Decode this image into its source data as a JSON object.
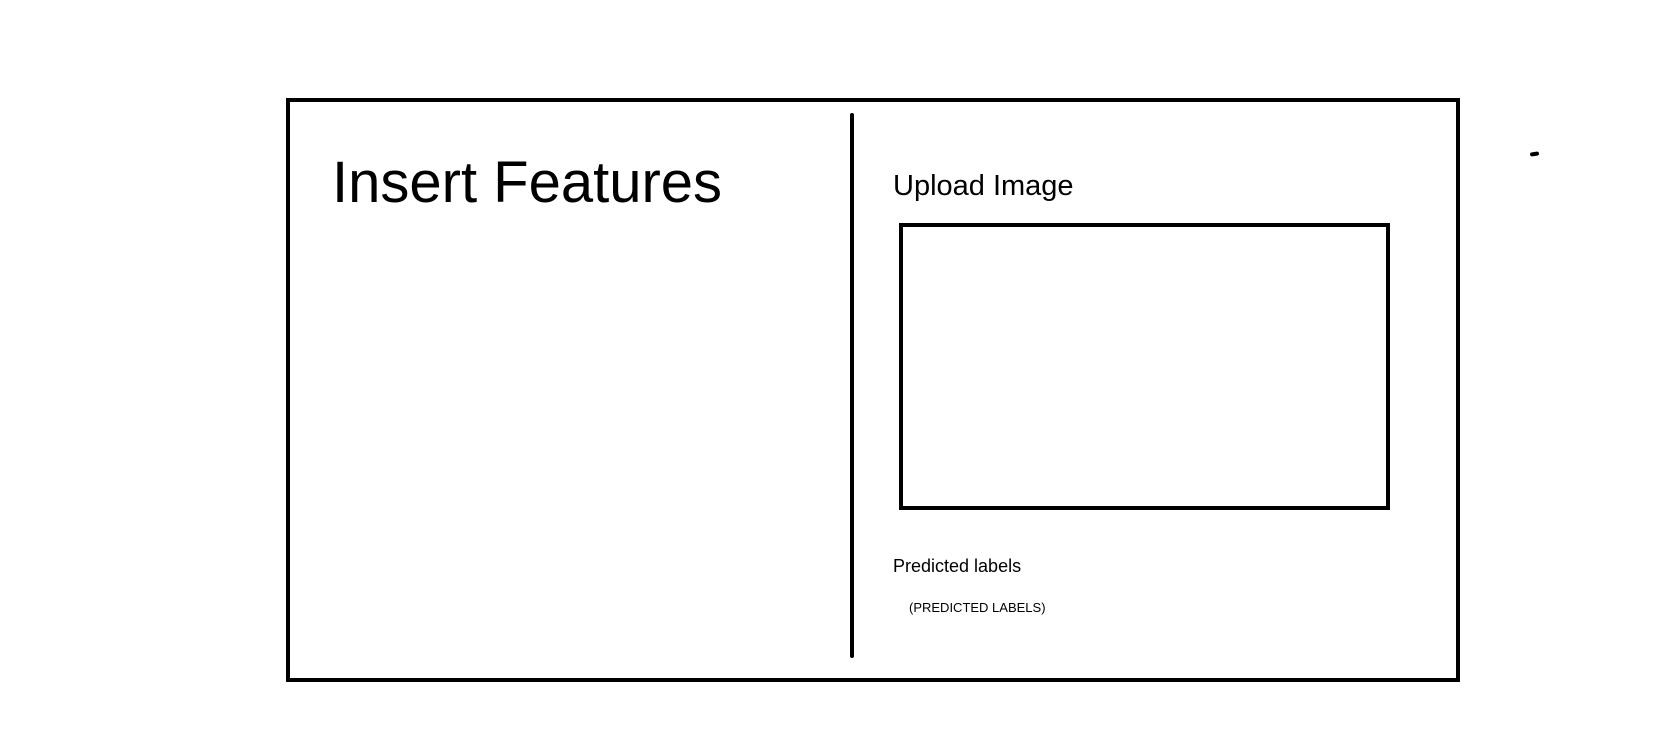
{
  "left_panel": {
    "title": "Insert Features"
  },
  "right_panel": {
    "upload_title": "Upload Image",
    "predicted_label_heading": "Predicted labels",
    "predicted_label_value": "(PREDICTED LABELS)"
  },
  "colors": {
    "stroke": "#000000",
    "background": "#ffffff"
  }
}
